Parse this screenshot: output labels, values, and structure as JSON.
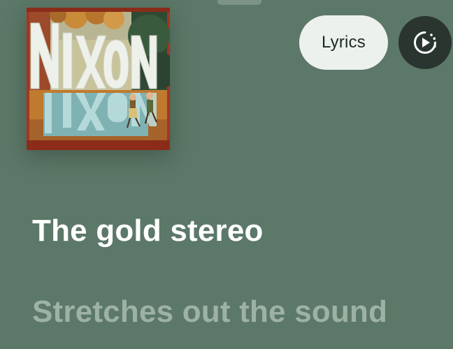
{
  "player": {
    "album_art": {
      "cover_text": "NIXON",
      "icon": "album-cover-image"
    },
    "lyrics_button": {
      "label": "Lyrics"
    },
    "autoplay_button": {
      "icon": "autoplay-icon"
    },
    "track": {
      "title": "The gold stereo"
    },
    "lyrics": {
      "next_line": "Stretches out the sound"
    }
  },
  "colors": {
    "background": "#5c7868",
    "title_text": "#ffffff",
    "lyric_text_dim": "#9db2a5",
    "lyrics_button_bg": "#edf1ee",
    "autoplay_button_bg": "#2a3530"
  }
}
